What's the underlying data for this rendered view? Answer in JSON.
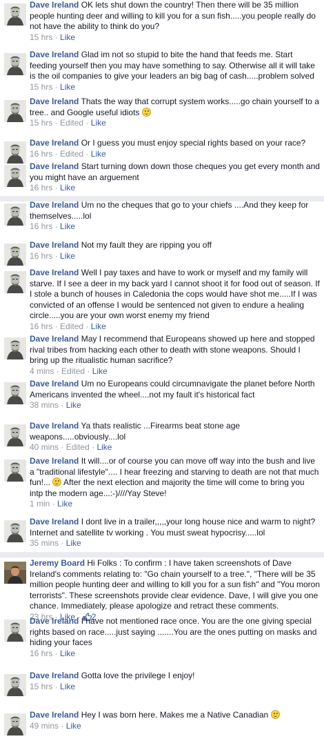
{
  "separators": {
    "edited": "Edited",
    "dot": "·"
  },
  "comments": [
    {
      "author": "Dave Ireland",
      "avatar_icon": "sketch-portrait-avatar-icon",
      "text": "OK lets shut down the country! Then there will be 35 million people hunting deer and willing to kill you for a sun fish.....you people really do not have the ability to think do you?",
      "time": "15 hrs",
      "edited": false,
      "like": "Like"
    },
    {
      "author": "Dave Ireland",
      "avatar_icon": "sketch-portrait-avatar-icon",
      "text": "Glad im not so stupid to bite the hand that feeds me. Start feeding yourself then you may have something to say. Otherwise all it will take is the oil companies to give your leaders an big bag of cash.....problem solved",
      "time": "15 hrs",
      "edited": false,
      "like": "Like"
    },
    {
      "author": "Dave Ireland",
      "avatar_icon": "sketch-portrait-avatar-icon",
      "text": "Thats the way that corrupt system works.....go chain yourself to a tree.. and Google useful idiots",
      "emoji": "smile-emoji-icon",
      "time": "15 hrs",
      "edited": true,
      "like": "Like"
    },
    {
      "author": "Dave Ireland",
      "avatar_icon": "sketch-portrait-avatar-icon",
      "text": "Or I guess you must enjoy special rights based on your race?",
      "time": "16 hrs",
      "edited": true,
      "like": "Like"
    },
    {
      "author": "Dave Ireland",
      "avatar_icon": "sketch-portrait-avatar-icon",
      "text": "Start turning down down those cheques you get every month and you might have an arguement",
      "time": "16 hrs",
      "edited": false,
      "like": "Like"
    },
    {
      "author": "Dave Ireland",
      "avatar_icon": "sketch-portrait-avatar-icon",
      "text": "Um no the cheques that go to your chiefs ....And they keep for themselves.....lol",
      "time": "16 hrs",
      "edited": false,
      "like": "Like"
    },
    {
      "author": "Dave Ireland",
      "avatar_icon": "sketch-portrait-avatar-icon",
      "text": "Not my fault they are ripping you off",
      "time": "16 hrs",
      "edited": false,
      "like": "Like"
    },
    {
      "author": "Dave Ireland",
      "avatar_icon": "sketch-portrait-avatar-icon",
      "text": "Well I pay taxes and have to work or myself and my family will starve. If I see a deer in my back yard I cannot shoot it for food out of season. If I stole a bunch of houses in Caledonia the cops would have shot me.....If I was convicted of an offense I would be sentenced not given to endure a healing circle.....you are your own worst enemy my friend",
      "time": "16 hrs",
      "edited": true,
      "like": "Like"
    },
    {
      "author": "Dave Ireland",
      "avatar_icon": "sketch-portrait-avatar-icon",
      "text": "May I recommend that Europeans showed up here and stopped rival tribes from hacking each other to death with stone weapons. Should I bring up the ritualistic human sacrifice?",
      "time": "4 mins",
      "edited": true,
      "like": "Like"
    },
    {
      "author": "Dave Ireland",
      "avatar_icon": "sketch-portrait-avatar-icon",
      "text": "Um no Europeans could circumnavigate the planet before North Americans invented the wheel....not my fault it's historical fact",
      "time": "38 mins",
      "edited": false,
      "like": "Like"
    },
    {
      "author": "Dave Ireland",
      "avatar_icon": "sketch-portrait-avatar-icon",
      "text": "Ya thats realistic ...Firearms beat stone age weapons.....obviously....lol",
      "time": "40 mins",
      "edited": true,
      "like": "Like"
    },
    {
      "author": "Dave Ireland",
      "avatar_icon": "sketch-portrait-avatar-icon",
      "text": "It will....or of course you can move off way into the bush and live a \"traditional lifestyle\".... I hear freezing and starving to death are not that much fun!...",
      "emoji": "smile-emoji-icon",
      "text_after": " After the next election and majority the time will come to bring you intp the modern age...:-)////Yay Steve!",
      "time": "1 min",
      "edited": false,
      "like": "Like"
    },
    {
      "author": "Dave Ireland",
      "avatar_icon": "sketch-portrait-avatar-icon",
      "text": "I dont live in a trailer,,,,,your long house nice and warm to night? Internet and satellite tv working . You must sweat hypocrisy.....lol",
      "time": "35 mins",
      "edited": false,
      "like": "Like"
    },
    {
      "author": "Jeremy Board",
      "avatar_icon": "photo-avatar-icon",
      "text": "Hi Folks : To confirm : I have taken screenshots of Dave Ireland's comments relating to: \"Go chain yourself to a tree.\", \"There will be 35 million people hunting deer and willing to kill you for a sun fish\" and \"You moron terrorists\". These screenshots provide clear evidence. Dave, I will give you one chance. Immediately, please apologize and retract these comments.",
      "time": "23 hrs",
      "edited": false,
      "like": "Like",
      "like_count": "2",
      "like_icon": "thumbs-up-icon"
    },
    {
      "author": "Dave Ireland",
      "avatar_icon": "sketch-portrait-avatar-icon",
      "text": "I have not mentioned race once. You are the one giving special rights based on race.....just saying .......You are the ones putting on masks and hiding your faces",
      "time": "16 hrs",
      "edited": false,
      "like": "Like"
    },
    {
      "author": "Dave Ireland",
      "avatar_icon": "sketch-portrait-avatar-icon",
      "text": "Gotta love the privilege I enjoy!",
      "time": "15 hrs",
      "edited": false,
      "like": "Like"
    },
    {
      "author": "Dave Ireland",
      "avatar_icon": "sketch-portrait-avatar-icon",
      "text": "Hey I was born here. Makes me a Native Canadian",
      "emoji": "smile-emoji-icon",
      "time": "49 mins",
      "edited": false,
      "like": "Like"
    }
  ]
}
